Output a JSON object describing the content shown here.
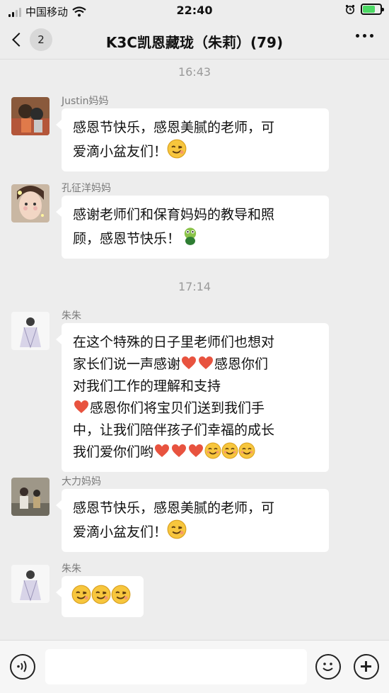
{
  "status_bar": {
    "carrier": "中国移动",
    "time": "22:40"
  },
  "nav": {
    "back_badge": "2",
    "title": "K3C凯恩藏珑（朱莉）(79)"
  },
  "chat": {
    "timestamps": [
      "16:43",
      "17:14"
    ],
    "messages": [
      {
        "sender": "Justin妈妈",
        "lines": [
          "感恩节快乐，感恩美腻的老师，可",
          "爱滴小盆友们！"
        ]
      },
      {
        "sender": "孔征洋妈妈",
        "lines": [
          "感谢老师们和保育妈妈的教导和照",
          "顾，感恩节快乐！"
        ]
      },
      {
        "sender": "朱朱",
        "lines": [
          "在这个特殊的日子里老师们也想对",
          "家长们说一声感谢",
          "感恩你们",
          "对我们工作的理解和支持",
          "感恩你们将宝贝们送到我们手",
          "中，让我们陪伴孩子们幸福的成长",
          "我们爱你们哟"
        ]
      },
      {
        "sender": "大力妈妈",
        "lines": [
          "感恩节快乐，感恩美腻的老师，可",
          "爱滴小盆友们！"
        ]
      },
      {
        "sender": "朱朱",
        "lines": []
      }
    ]
  },
  "icons": {
    "wink": "wink-emoji-icon",
    "heart": "heart-emoji-icon",
    "smile": "smile-emoji-icon",
    "frog": "frog-emoji-icon"
  },
  "colors": {
    "background": "#ededed",
    "bubble": "#ffffff",
    "battery_fill": "#4cd964",
    "heart": "#e8533f"
  }
}
